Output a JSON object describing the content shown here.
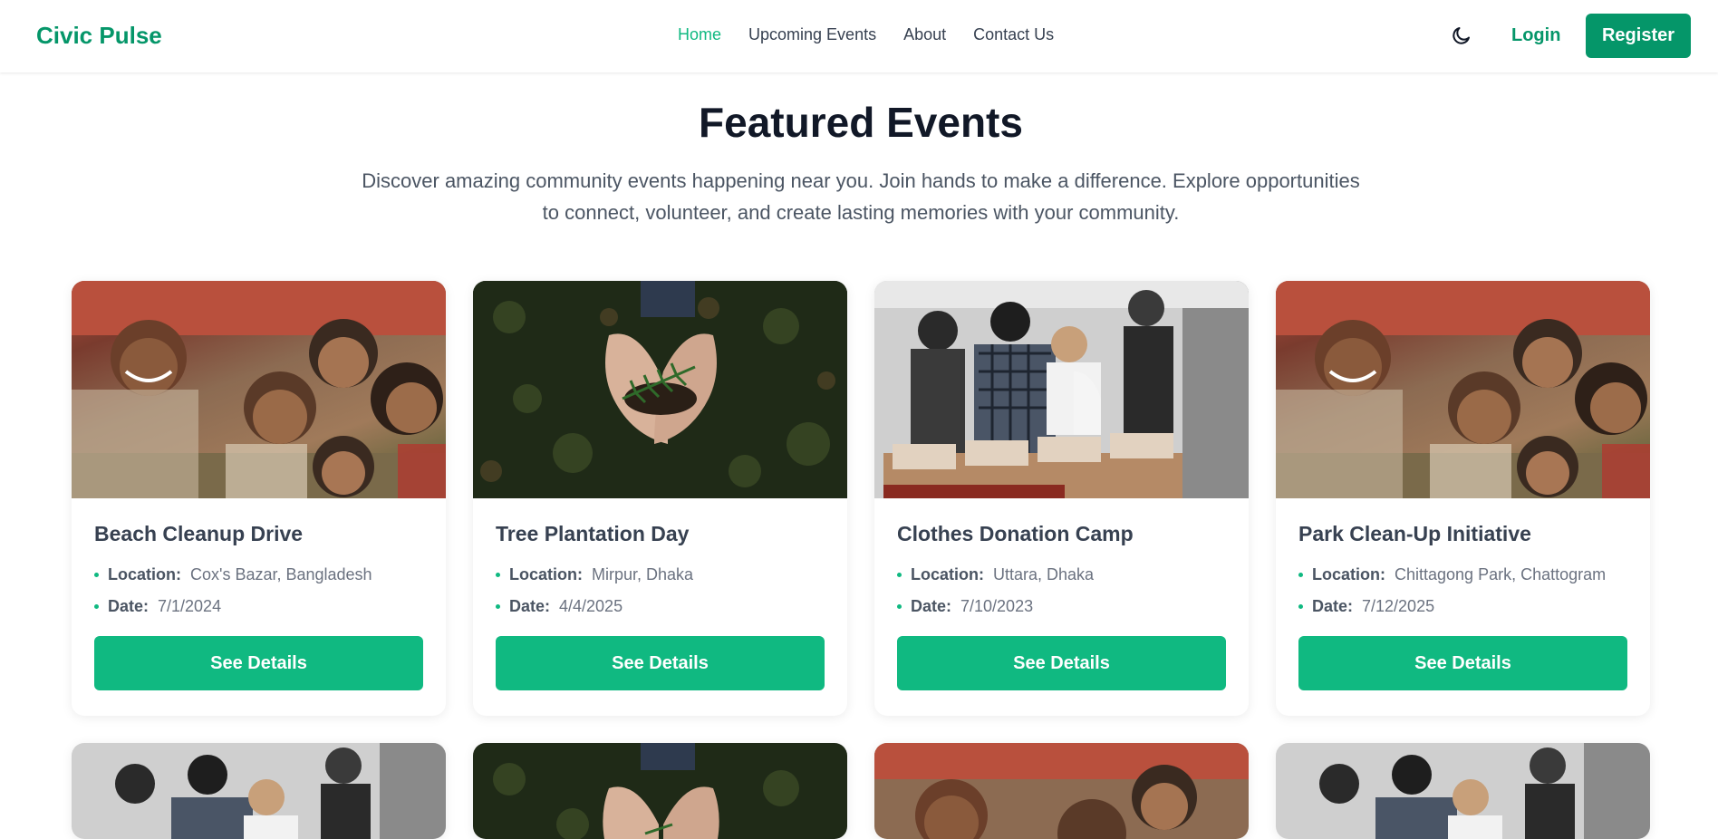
{
  "nav": {
    "brand": "Civic Pulse",
    "links": [
      "Home",
      "Upcoming Events",
      "About",
      "Contact Us"
    ],
    "login": "Login",
    "register": "Register",
    "theme_icon": "moon-icon"
  },
  "hero": {
    "title": "Featured Events",
    "subtitle_line1": "Discover amazing community events happening near you. Join hands to make a difference. Explore opportunities",
    "subtitle_line2": "to connect, volunteer, and create lasting memories with your community."
  },
  "labels": {
    "location": "Location:",
    "date": "Date:",
    "details": "See Details"
  },
  "events": [
    {
      "title": "Beach Cleanup Drive",
      "location": "Cox's Bazar, Bangladesh",
      "date": "7/1/2024",
      "image": "kids-photo"
    },
    {
      "title": "Tree Plantation Day",
      "location": "Mirpur, Dhaka",
      "date": "4/4/2025",
      "image": "plant-photo"
    },
    {
      "title": "Clothes Donation Camp",
      "location": "Uttara, Dhaka",
      "date": "7/10/2023",
      "image": "donation-photo"
    },
    {
      "title": "Park Clean-Up Initiative",
      "location": "Chittagong Park, Chattogram",
      "date": "7/12/2025",
      "image": "kids-photo"
    }
  ],
  "more_events_images": [
    "donation-photo",
    "plant-photo",
    "kids-photo",
    "donation-photo"
  ],
  "colors": {
    "brand": "#059669",
    "accent": "#10b981",
    "heading": "#111827"
  }
}
